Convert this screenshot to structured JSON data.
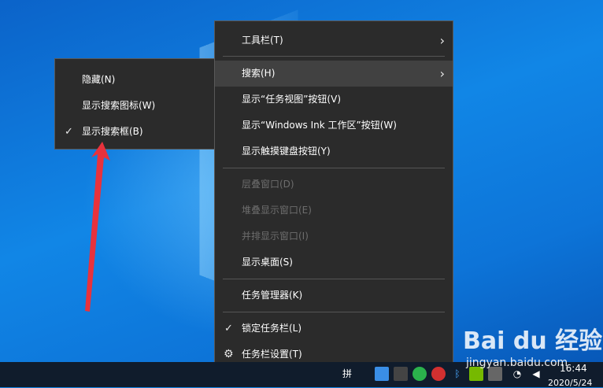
{
  "main_menu": {
    "items": [
      {
        "label": "工具栏(T)",
        "has_submenu": true
      },
      {
        "label": "搜索(H)",
        "has_submenu": true,
        "highlighted": true
      },
      {
        "label": "显示“任务视图”按钮(V)"
      },
      {
        "label": "显示“Windows Ink 工作区”按钮(W)"
      },
      {
        "label": "显示触摸键盘按钮(Y)"
      },
      {
        "label": "层叠窗口(D)",
        "disabled": true
      },
      {
        "label": "堆叠显示窗口(E)",
        "disabled": true
      },
      {
        "label": "并排显示窗口(I)",
        "disabled": true
      },
      {
        "label": "显示桌面(S)"
      },
      {
        "label": "任务管理器(K)"
      },
      {
        "label": "锁定任务栏(L)",
        "checked": true
      },
      {
        "label": "任务栏设置(T)",
        "icon": "gear-icon"
      }
    ]
  },
  "sub_menu": {
    "items": [
      {
        "label": "隐藏(N)"
      },
      {
        "label": "显示搜索图标(W)"
      },
      {
        "label": "显示搜索框(B)",
        "checked": true
      }
    ]
  },
  "taskbar": {
    "ime_label": "拼",
    "time": "16:44",
    "date": "2020/5/24"
  },
  "watermark": {
    "brand": "Bai du 经验",
    "url": "jingyan.baidu.com"
  },
  "colors": {
    "menu_bg": "#2b2b2b",
    "menu_highlight": "#414141",
    "arrow": "#e8323c"
  }
}
